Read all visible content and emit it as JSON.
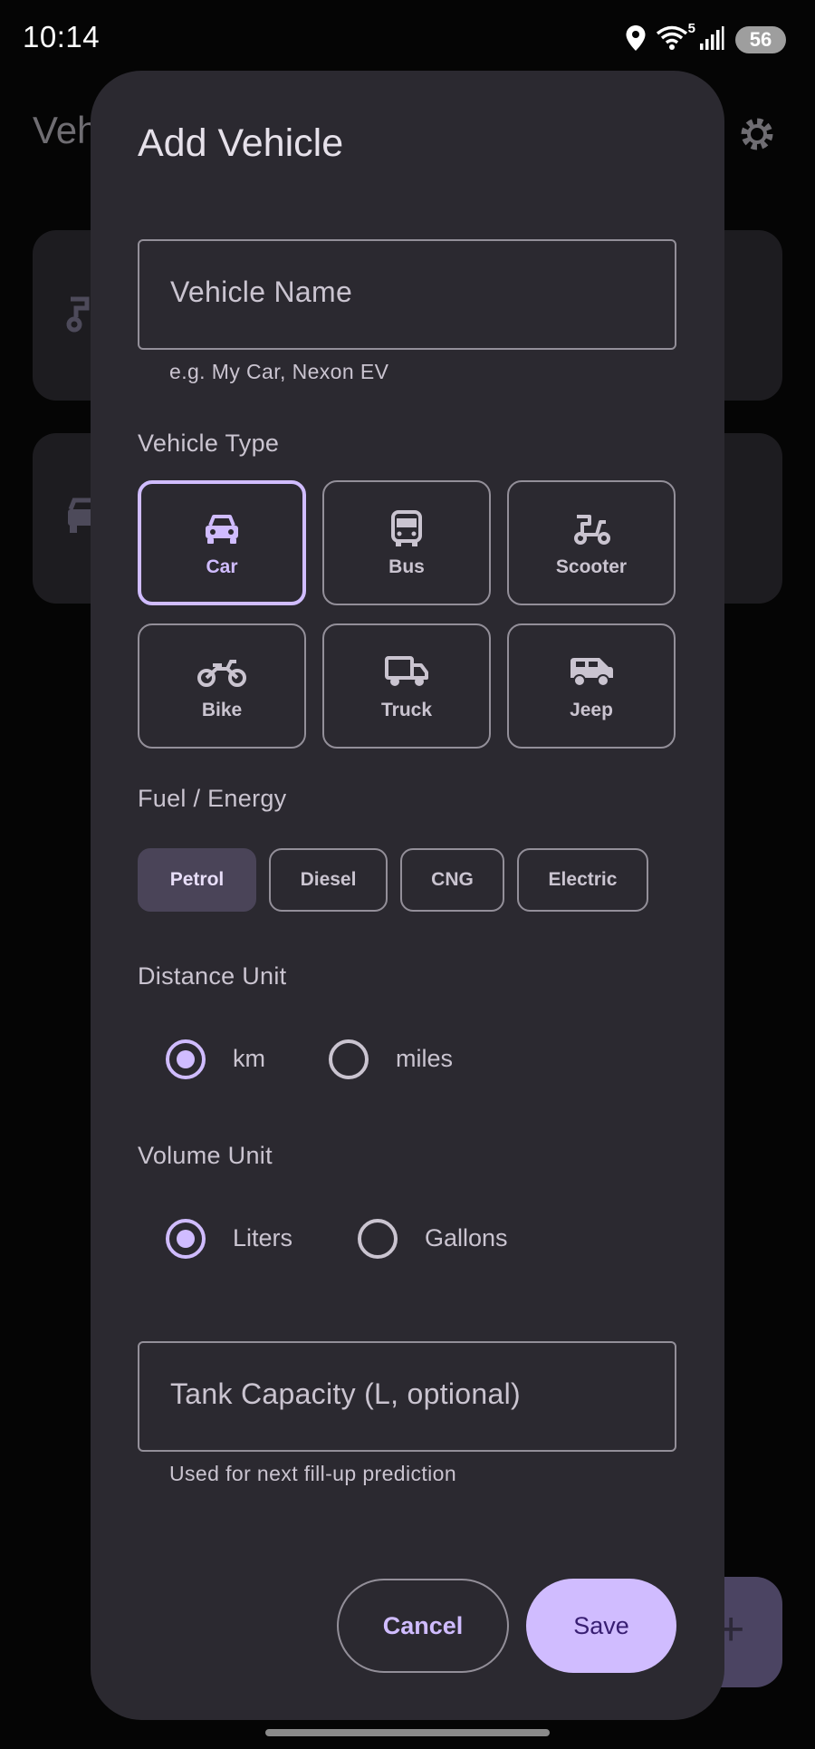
{
  "status_bar": {
    "time": "10:14",
    "wifi_badge": "5",
    "battery": "56"
  },
  "background_app": {
    "title_fragment": "Veh",
    "fab_symbol": "+"
  },
  "dialog": {
    "title": "Add Vehicle",
    "vehicle_name": {
      "placeholder": "Vehicle Name",
      "value": "",
      "helper": "e.g. My Car, Nexon EV"
    },
    "vehicle_type": {
      "label": "Vehicle Type",
      "selected": "Car",
      "options": [
        {
          "label": "Car",
          "icon": "car-icon"
        },
        {
          "label": "Bus",
          "icon": "bus-icon"
        },
        {
          "label": "Scooter",
          "icon": "scooter-icon"
        },
        {
          "label": "Bike",
          "icon": "motorcycle-icon"
        },
        {
          "label": "Truck",
          "icon": "truck-icon"
        },
        {
          "label": "Jeep",
          "icon": "jeep-icon"
        }
      ]
    },
    "fuel": {
      "label": "Fuel / Energy",
      "selected": "Petrol",
      "options": [
        "Petrol",
        "Diesel",
        "CNG",
        "Electric"
      ]
    },
    "distance_unit": {
      "label": "Distance Unit",
      "selected": "km",
      "options": [
        "km",
        "miles"
      ]
    },
    "volume_unit": {
      "label": "Volume Unit",
      "selected": "Liters",
      "options": [
        "Liters",
        "Gallons"
      ]
    },
    "tank_capacity": {
      "placeholder": "Tank Capacity (L, optional)",
      "value": "",
      "helper": "Used for next fill-up prediction"
    },
    "buttons": {
      "cancel": "Cancel",
      "save": "Save"
    }
  },
  "colors": {
    "accent": "#d0bcff",
    "surface": "#2b2930",
    "outline": "#938f99",
    "chip_selected": "#4a4458"
  }
}
